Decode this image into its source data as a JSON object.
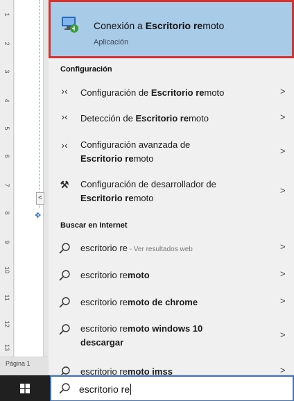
{
  "best_match": {
    "title_plain": "Conexión a ",
    "title_bold1": "Escritorio re",
    "title_tail": "moto",
    "subtitle": "Aplicación"
  },
  "sections": {
    "config": "Configuración",
    "internet": "Buscar en Internet"
  },
  "settings": [
    {
      "pre": "Configuración de ",
      "bold": "Escritorio re",
      "post": "moto"
    },
    {
      "pre": "Detección de ",
      "bold": "Escritorio re",
      "post": "moto"
    },
    {
      "pre": "Configuración avanzada de",
      "line2_bold": "Escritorio re",
      "line2_post": "moto"
    },
    {
      "pre": "Configuración de desarrollador de",
      "line2_bold": "Escritorio re",
      "line2_post": "moto"
    }
  ],
  "web": [
    {
      "pre": "escritorio re",
      "hint": " - Ver resultados web",
      "bold": ""
    },
    {
      "pre": "escritorio re",
      "bold": "moto"
    },
    {
      "pre": "escritorio re",
      "bold": "moto de chrome"
    },
    {
      "pre": "escritorio re",
      "bold": "moto windows 10",
      "line2_bold": "descargar"
    },
    {
      "pre": "escritorio re",
      "bold": "moto imss"
    }
  ],
  "chevron": ">",
  "search": {
    "query": "escritorio re"
  },
  "word": {
    "status_page": "Página 1",
    "ruler": [
      "1",
      "2",
      "3",
      "4",
      "5",
      "6",
      "7",
      "8",
      "9",
      "10",
      "11",
      "12",
      "13"
    ]
  },
  "colors": {
    "highlight": "#a8cbe8",
    "border": "#d8302b",
    "taskbar_start": "#202020",
    "search_border": "#3a72c4"
  },
  "icons": [
    "remote-desktop-icon",
    "settings-arrow-icon",
    "developer-settings-icon",
    "search-icon",
    "windows-logo-icon"
  ]
}
